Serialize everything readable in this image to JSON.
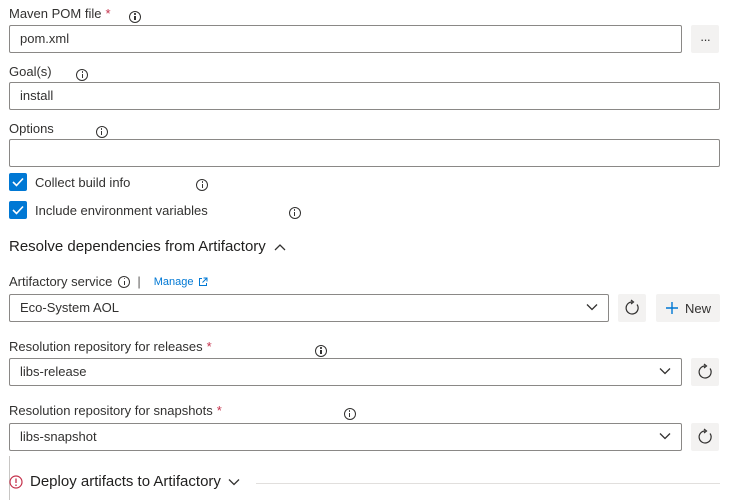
{
  "maven_pom": {
    "label": "Maven POM file",
    "required_mark": "*",
    "value": "pom.xml",
    "browse_label": "···"
  },
  "goals": {
    "label": "Goal(s)",
    "value": "install"
  },
  "options": {
    "label": "Options",
    "value": ""
  },
  "checkboxes": [
    {
      "label": "Collect build info",
      "checked": true
    },
    {
      "label": "Include environment variables",
      "checked": true
    }
  ],
  "resolve_section": {
    "title": "Resolve dependencies from Artifactory",
    "expanded": true
  },
  "artifactory_service": {
    "label": "Artifactory service",
    "separator": "|",
    "manage_label": "Manage",
    "value": "Eco-System AOL",
    "new_label": "New"
  },
  "releases_repo": {
    "label": "Resolution repository for releases",
    "required_mark": "*",
    "value": "libs-release"
  },
  "snapshots_repo": {
    "label": "Resolution repository for snapshots",
    "required_mark": "*",
    "value": "libs-snapshot"
  },
  "deploy_section": {
    "title": "Deploy artifacts to Artifactory",
    "expanded": false
  },
  "colors": {
    "accent": "#0078d4",
    "error": "#c4314b",
    "border": "#8a8886",
    "button_bg": "#f3f2f1"
  },
  "icons": [
    "info-icon",
    "ellipsis-icon",
    "checkmark-icon",
    "chevron-up-icon",
    "chevron-down-icon",
    "external-link-icon",
    "refresh-icon",
    "plus-icon",
    "error-icon"
  ]
}
